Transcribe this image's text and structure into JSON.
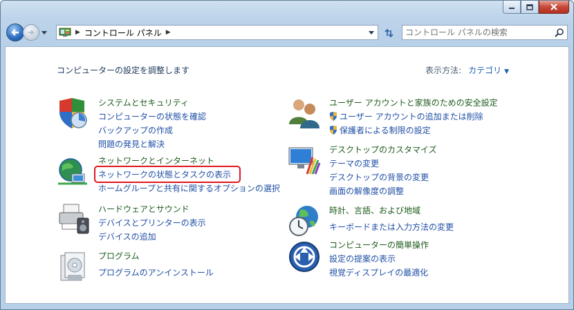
{
  "window": {
    "buttons": {
      "minimize": "minimize",
      "maximize": "maximize",
      "close": "close"
    }
  },
  "navigation": {
    "breadcrumb": [
      "コントロール パネル"
    ],
    "search_placeholder": "コントロール パネルの検索"
  },
  "main": {
    "heading": "コンピューターの設定を調整します",
    "view_by_label": "表示方法:",
    "view_by_value": "カテゴリ"
  },
  "categories": [
    {
      "title": "システムとセキュリティ",
      "icon": "system-security-icon",
      "links": [
        "コンピューターの状態を確認",
        "バックアップの作成",
        "問題の発見と解決"
      ]
    },
    {
      "title": "ネットワークとインターネット",
      "icon": "network-internet-icon",
      "links": [
        "ネットワークの状態とタスクの表示",
        "ホームグループと共有に関するオプションの選択"
      ]
    },
    {
      "title": "ハードウェアとサウンド",
      "icon": "hardware-sound-icon",
      "links": [
        "デバイスとプリンターの表示",
        "デバイスの追加"
      ]
    },
    {
      "title": "プログラム",
      "icon": "programs-icon",
      "links": [
        "プログラムのアンインストール"
      ]
    },
    {
      "title": "ユーザー アカウントと家族のための安全設定",
      "icon": "user-accounts-icon",
      "links": [
        "ユーザー アカウントの追加または削除",
        "保護者による制限の設定"
      ]
    },
    {
      "title": "デスクトップのカスタマイズ",
      "icon": "appearance-icon",
      "links": [
        "テーマの変更",
        "デスクトップの背景の変更",
        "画面の解像度の調整"
      ]
    },
    {
      "title": "時計、言語、および地域",
      "icon": "clock-language-region-icon",
      "links": [
        "キーボードまたは入力方法の変更"
      ]
    },
    {
      "title": "コンピューターの簡単操作",
      "icon": "ease-of-access-icon",
      "links": [
        "設定の提案の表示",
        "視覚ディスプレイの最適化"
      ]
    }
  ],
  "colors": {
    "title_green": "#1e5c1e",
    "link_blue": "#1f4fa6",
    "highlight_red": "#e0141e"
  }
}
